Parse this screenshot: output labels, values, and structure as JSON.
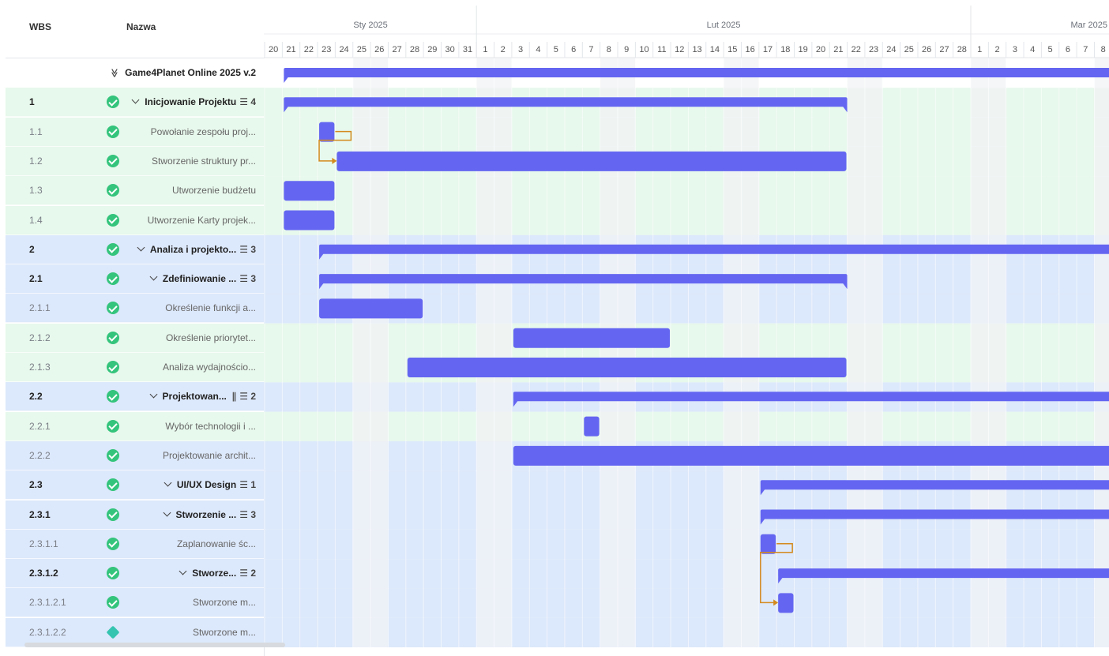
{
  "columns": {
    "wbs": "WBS",
    "name": "Nazwa"
  },
  "months": [
    {
      "label": "Sty 2025",
      "start": 0,
      "days": 12
    },
    {
      "label": "Lut 2025",
      "start": 12,
      "days": 28
    },
    {
      "label": "Mar 2025",
      "start": 40,
      "days": 8
    }
  ],
  "days": [
    "20",
    "21",
    "22",
    "23",
    "24",
    "25",
    "26",
    "27",
    "28",
    "29",
    "30",
    "31",
    "1",
    "2",
    "3",
    "4",
    "5",
    "6",
    "7",
    "8",
    "9",
    "10",
    "11",
    "12",
    "13",
    "14",
    "15",
    "16",
    "17",
    "18",
    "19",
    "20",
    "21",
    "22",
    "23",
    "24",
    "25",
    "26",
    "27",
    "28",
    "1",
    "2",
    "3",
    "4",
    "5",
    "6",
    "7",
    "8"
  ],
  "weekend_days": [
    5,
    6,
    12,
    13,
    19,
    20,
    26,
    27,
    33,
    34,
    40,
    41,
    47
  ],
  "colors": {
    "bar": "#6466f1",
    "link": "#d48a1e",
    "green_bg": "#e7f8ec",
    "blue_bg": "#dce8fb",
    "status": "#34c47c"
  },
  "icons": {
    "status": "check-circle-icon",
    "milestone": "diamond-icon",
    "subtasks": "subtasks-icon",
    "attachment": "paperclip-icon"
  },
  "rows": [
    {
      "wbs": "",
      "name": "Game4Planet Online 2025 v.2",
      "bg": "white",
      "kind": "root",
      "start": 1,
      "end": 48
    },
    {
      "wbs": "1",
      "name": "Inicjowanie Projektu",
      "subtasks": "4",
      "bg": "green",
      "kind": "parent",
      "start": 1,
      "end": 33
    },
    {
      "wbs": "1.1",
      "name": "Powołanie zespołu proj...",
      "bg": "green",
      "kind": "task",
      "start": 3,
      "end": 4
    },
    {
      "wbs": "1.2",
      "name": "Stworzenie struktury pr...",
      "bg": "green",
      "kind": "task",
      "start": 4,
      "end": 33
    },
    {
      "wbs": "1.3",
      "name": "Utworzenie budżetu",
      "bg": "green",
      "kind": "task",
      "start": 1,
      "end": 4
    },
    {
      "wbs": "1.4",
      "name": "Utworzenie Karty projek...",
      "bg": "green",
      "kind": "task",
      "start": 1,
      "end": 4
    },
    {
      "wbs": "2",
      "name": "Analiza i projekto...",
      "subtasks": "3",
      "bg": "blue",
      "kind": "parent",
      "start": 3,
      "end": 48
    },
    {
      "wbs": "2.1",
      "name": "Zdefiniowanie ...",
      "subtasks": "3",
      "bg": "blue",
      "kind": "parent",
      "start": 3,
      "end": 33
    },
    {
      "wbs": "2.1.1",
      "name": "Określenie funkcji a...",
      "bg": "blue",
      "kind": "task",
      "start": 3,
      "end": 9
    },
    {
      "wbs": "2.1.2",
      "name": "Określenie priorytet...",
      "bg": "green",
      "kind": "task",
      "start": 14,
      "end": 23
    },
    {
      "wbs": "2.1.3",
      "name": "Analiza wydajnościo...",
      "bg": "green",
      "kind": "task",
      "start": 8,
      "end": 33
    },
    {
      "wbs": "2.2",
      "name": "Projektowan...",
      "subtasks": "2",
      "attachment": true,
      "bg": "blue",
      "kind": "parent",
      "start": 14,
      "end": 48
    },
    {
      "wbs": "2.2.1",
      "name": "Wybór technologii i ...",
      "bg": "green",
      "kind": "task",
      "start": 18,
      "end": 19
    },
    {
      "wbs": "2.2.2",
      "name": "Projektowanie archit...",
      "bg": "blue",
      "kind": "task",
      "start": 14,
      "end": 48
    },
    {
      "wbs": "2.3",
      "name": "UI/UX Design",
      "subtasks": "1",
      "bg": "blue",
      "kind": "parent",
      "start": 28,
      "end": 48
    },
    {
      "wbs": "2.3.1",
      "name": "Stworzenie ...",
      "subtasks": "3",
      "bg": "blue",
      "kind": "parent",
      "start": 28,
      "end": 48
    },
    {
      "wbs": "2.3.1.1",
      "name": "Zaplanowanie śc...",
      "bg": "blue",
      "kind": "task",
      "start": 28,
      "end": 29
    },
    {
      "wbs": "2.3.1.2",
      "name": "Stworze...",
      "subtasks": "2",
      "bg": "blue",
      "kind": "parent",
      "start": 29,
      "end": 48
    },
    {
      "wbs": "2.3.1.2.1",
      "name": "Stworzone m...",
      "bg": "blue",
      "kind": "task",
      "start": 29,
      "end": 30
    },
    {
      "wbs": "2.3.1.2.2",
      "name": "Stworzone m...",
      "bg": "blue",
      "kind": "milestone",
      "start": 0,
      "end": 0
    }
  ],
  "links": [
    {
      "from": 2,
      "to": 3
    },
    {
      "from": 16,
      "to": 18
    }
  ]
}
